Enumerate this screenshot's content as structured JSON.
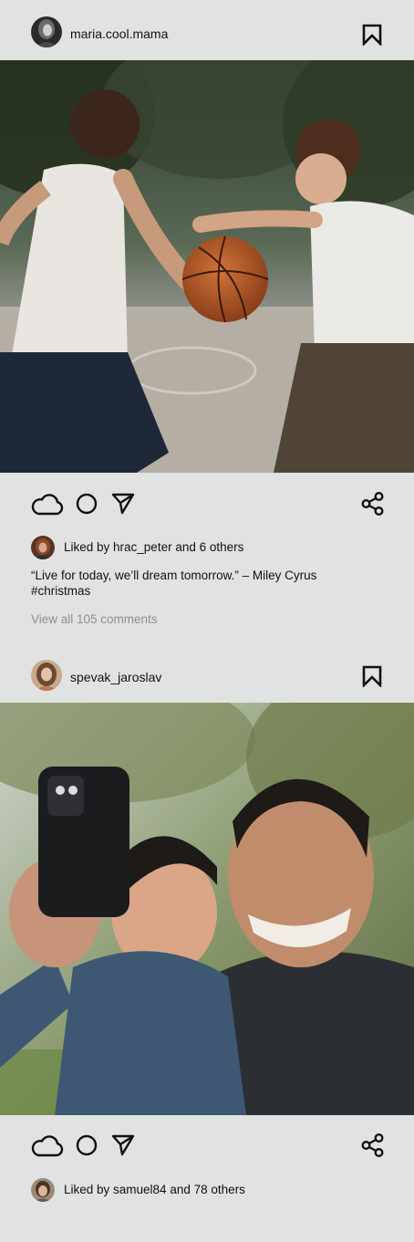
{
  "posts": [
    {
      "username": "maria.cool.mama",
      "photo_alt": "Two boys playing basketball outdoors",
      "liked_by_text": "Liked by hrac_peter and 6 others",
      "caption_line1": "“Live for today, we’ll dream tomorrow.” – Miley Cyrus",
      "caption_line2": "#christmas",
      "view_comments": "View all 105 comments"
    },
    {
      "username": "spevak_jaroslav",
      "photo_alt": "Father and child taking a selfie in a park",
      "liked_by_text": "Liked by samuel84 and 78 others"
    }
  ],
  "icons": {
    "like": "cloud-icon",
    "comment": "circle-icon",
    "send": "send-arrow-icon",
    "share": "share-icon",
    "save": "bookmark-icon"
  },
  "colors": {
    "background": "#e1e3e2",
    "text": "#111111",
    "muted": "#8c8f8e"
  }
}
